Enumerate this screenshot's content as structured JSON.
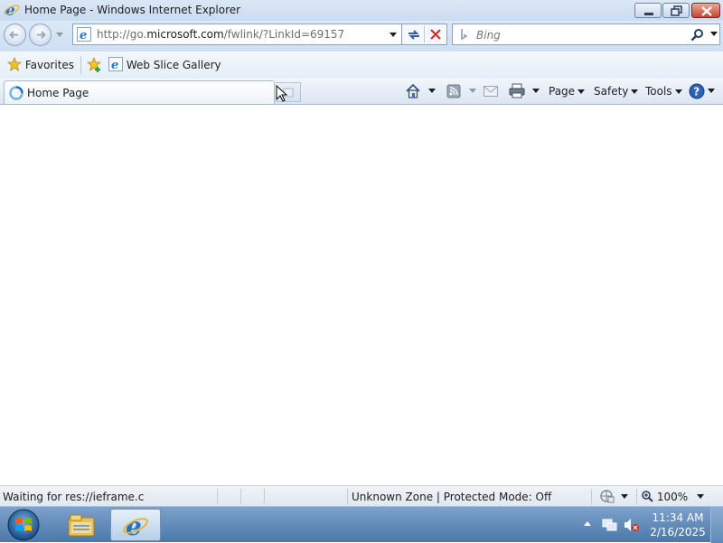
{
  "window": {
    "title": "Home Page - Windows Internet Explorer"
  },
  "address_bar": {
    "url_prefix": "http://go.",
    "url_domain": "microsoft.com",
    "url_path": "/fwlink/?LinkId=69157"
  },
  "search": {
    "placeholder": "Bing"
  },
  "favorites_bar": {
    "favorites_label": "Favorites",
    "web_slice_label": "Web Slice Gallery"
  },
  "tab": {
    "title": "Home Page"
  },
  "command_bar": {
    "page_label": "Page",
    "safety_label": "Safety",
    "tools_label": "Tools"
  },
  "status_bar": {
    "status_text": "Waiting for res://ieframe.c",
    "zone_text": "Unknown Zone | Protected Mode: Off",
    "zoom": "100%"
  },
  "taskbar": {
    "time": "11:34 AM",
    "date": "2/16/2025"
  },
  "icons": [
    "ie-icon",
    "back-icon",
    "forward-icon",
    "refresh-icon",
    "stop-icon",
    "search-icon",
    "favorites-star-icon",
    "add-favorites-icon",
    "home-icon",
    "rss-icon",
    "mail-icon",
    "print-icon",
    "help-icon",
    "start-orb-icon",
    "explorer-icon",
    "flag-icon",
    "volume-muted-icon"
  ],
  "colors": {
    "title_bar": "#c9dcf2",
    "close_button": "#c7432b",
    "taskbar": "#4a78aa",
    "stop_red": "#d0302a"
  }
}
